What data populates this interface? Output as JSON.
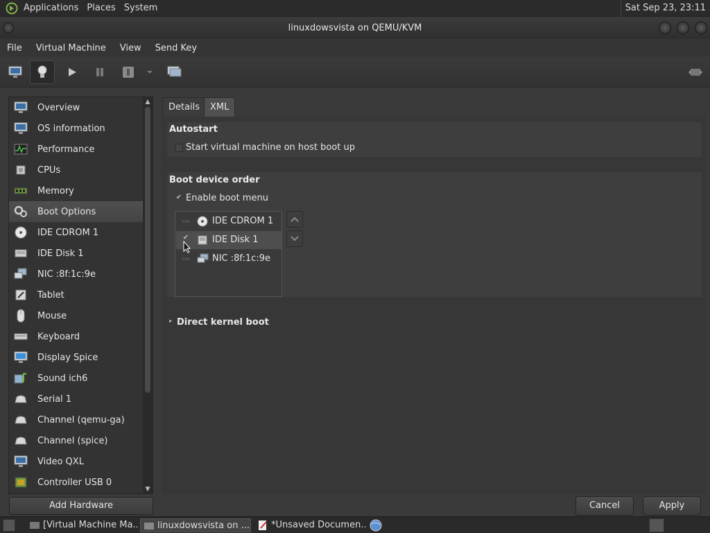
{
  "top_panel": {
    "menus": [
      "Applications",
      "Places",
      "System"
    ],
    "clock": "Sat Sep 23, 23:11"
  },
  "window": {
    "title": "linuxdowsvista on QEMU/KVM"
  },
  "menubar": [
    "File",
    "Virtual Machine",
    "View",
    "Send Key"
  ],
  "sidebar": {
    "items": [
      {
        "label": "Overview",
        "icon": "monitor-icon"
      },
      {
        "label": "OS information",
        "icon": "monitor-icon"
      },
      {
        "label": "Performance",
        "icon": "performance-graph-icon"
      },
      {
        "label": "CPUs",
        "icon": "cpu-icon"
      },
      {
        "label": "Memory",
        "icon": "memory-icon"
      },
      {
        "label": "Boot Options",
        "icon": "gears-icon"
      },
      {
        "label": "IDE CDROM 1",
        "icon": "cdrom-icon"
      },
      {
        "label": "IDE Disk 1",
        "icon": "disk-icon"
      },
      {
        "label": "NIC :8f:1c:9e",
        "icon": "network-icon"
      },
      {
        "label": "Tablet",
        "icon": "tablet-icon"
      },
      {
        "label": "Mouse",
        "icon": "mouse-icon"
      },
      {
        "label": "Keyboard",
        "icon": "keyboard-icon"
      },
      {
        "label": "Display Spice",
        "icon": "display-icon"
      },
      {
        "label": "Sound ich6",
        "icon": "sound-icon"
      },
      {
        "label": "Serial 1",
        "icon": "serial-icon"
      },
      {
        "label": "Channel (qemu-ga)",
        "icon": "channel-icon"
      },
      {
        "label": "Channel (spice)",
        "icon": "channel-icon"
      },
      {
        "label": "Video QXL",
        "icon": "video-icon"
      },
      {
        "label": "Controller USB 0",
        "icon": "controller-icon"
      }
    ],
    "selected": "Boot Options",
    "add_hardware": "Add Hardware"
  },
  "tabs": [
    "Details",
    "XML"
  ],
  "autostart": {
    "title": "Autostart",
    "checkbox_label": "Start virtual machine on host boot up",
    "checked": false
  },
  "boot_order": {
    "title": "Boot device order",
    "enable_menu_label": "Enable boot menu",
    "enable_menu_checked": true,
    "devices": [
      {
        "label": "IDE CDROM 1",
        "icon": "cdrom-icon",
        "checked": false
      },
      {
        "label": "IDE Disk 1",
        "icon": "disk-icon",
        "checked": true
      },
      {
        "label": "NIC :8f:1c:9e",
        "icon": "network-icon",
        "checked": false
      }
    ],
    "up_icon": "chevron-up-icon",
    "down_icon": "chevron-down-icon"
  },
  "direct_kernel_boot": {
    "title": "Direct kernel boot",
    "expanded": false
  },
  "buttons": {
    "cancel": "Cancel",
    "apply": "Apply"
  },
  "taskbar": {
    "tasks": [
      {
        "label": "[Virtual Machine Ma..."
      },
      {
        "label": "linuxdowsvista on ..."
      },
      {
        "label": "*Unsaved Documen..."
      }
    ]
  },
  "colors": {
    "background": "#3a3a3a",
    "panel": "#2b2b2b",
    "selection": "#4e4e4e",
    "text": "#e6e6e6"
  }
}
